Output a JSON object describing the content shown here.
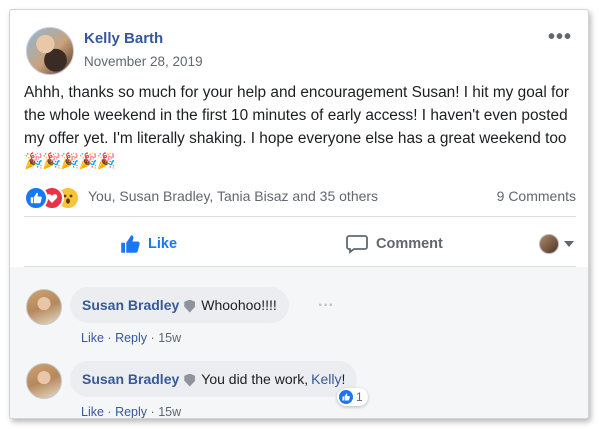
{
  "post": {
    "author": "Kelly Barth",
    "date": "November 28, 2019",
    "more_icon": "•••",
    "text": "Ahhh, thanks so much for your help and encouragement Susan! I hit my goal for the whole weekend in the first 10 minutes of early access! I haven't even posted my offer yet. I'm literally shaking. I hope everyone else has a great weekend too",
    "emojis": "🎉🎉🎉🎉🎉",
    "reactions": {
      "icons": [
        "like-icon",
        "love-icon",
        "wow-icon"
      ],
      "summary": "You, Susan Bradley, Tania Bisaz and 35 others",
      "comments_count": "9 Comments"
    },
    "actions": {
      "like_label": "Like",
      "comment_label": "Comment"
    }
  },
  "comments": [
    {
      "name": "Susan Bradley",
      "text": "Whoohoo!!!!",
      "link": "",
      "suffix": "",
      "like_label": "Like",
      "reply_label": "Reply",
      "sep": "·",
      "time": "15w"
    },
    {
      "name": "Susan Bradley",
      "text": "You did the work,",
      "link": "Kelly",
      "suffix": "!",
      "like_label": "Like",
      "reply_label": "Reply",
      "sep": "·",
      "time": "15w",
      "reaction_count": "1"
    }
  ],
  "colors": {
    "link": "#385898",
    "like_blue": "#1877f2",
    "muted": "#606770",
    "bubble": "#ebedf0"
  }
}
